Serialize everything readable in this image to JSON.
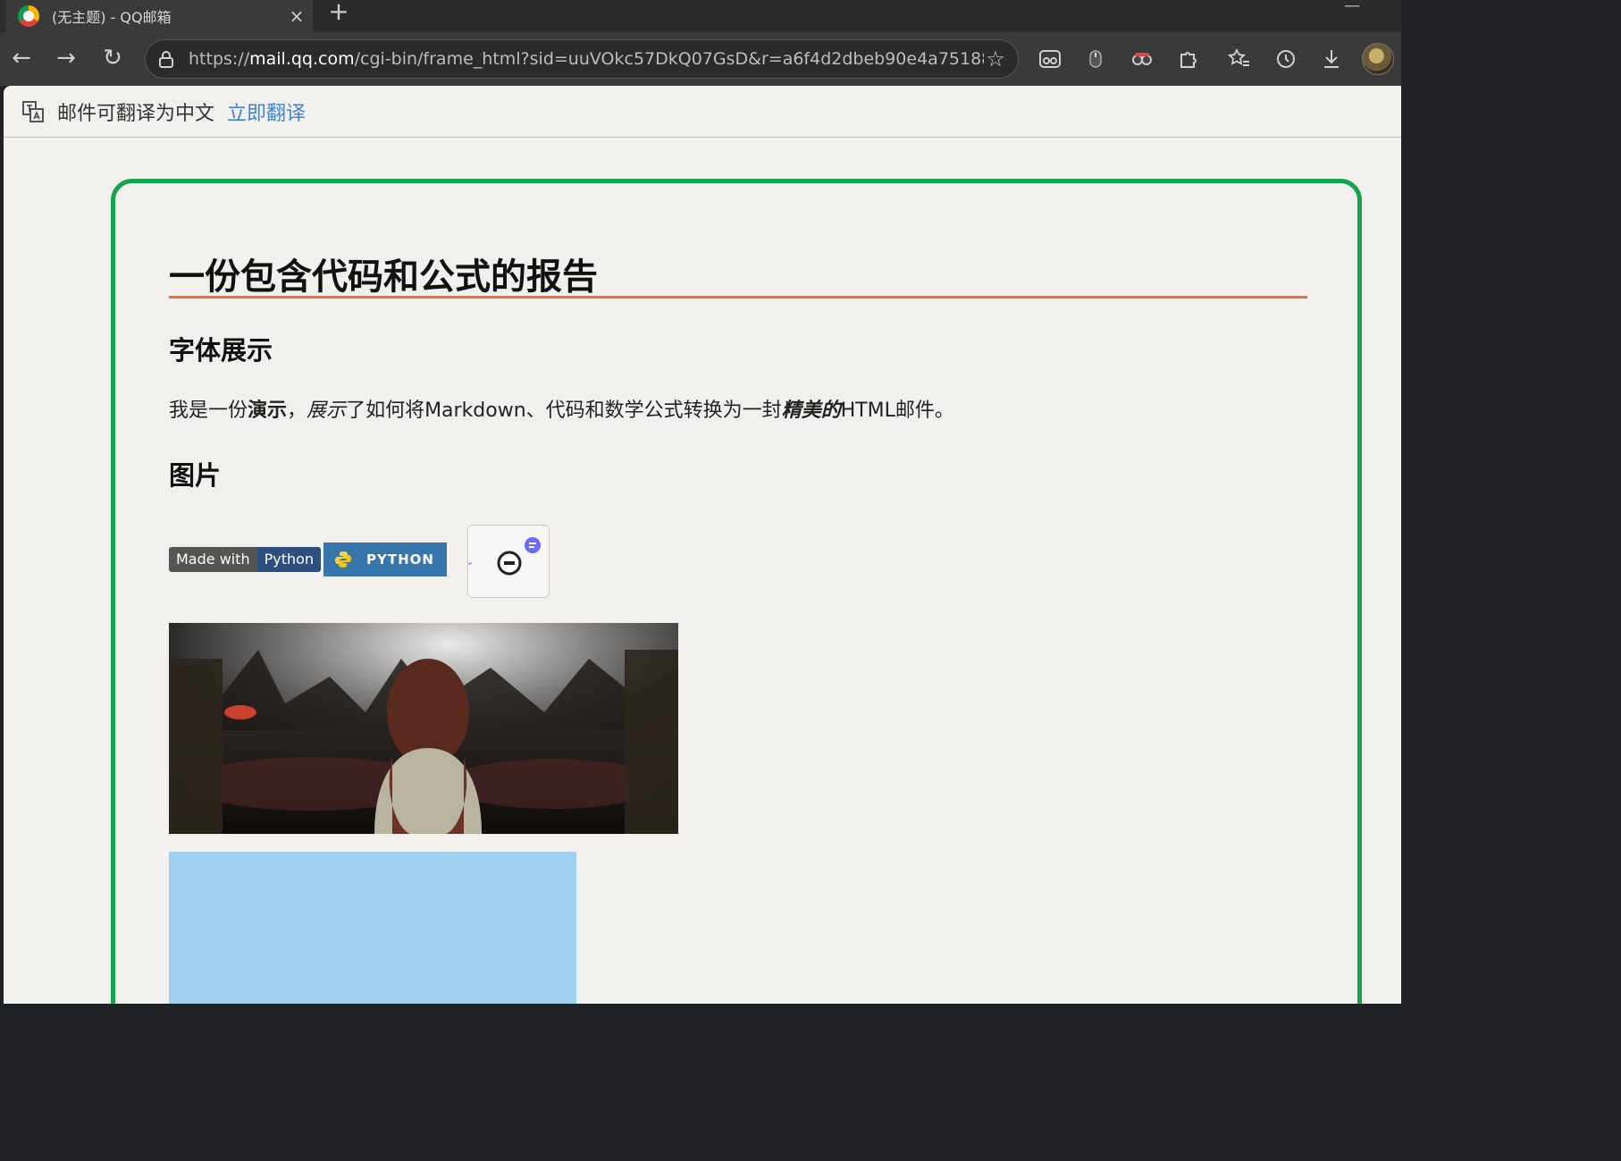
{
  "browser": {
    "tab_title": "(无主题) - QQ邮箱",
    "tab_close": "×",
    "new_tab": "+",
    "url_scheme": "https://",
    "url_host": "mail.qq.com",
    "url_rest": "/cgi-bin/frame_html?sid=uuVOkc57DkQ07GsD&r=a6f4d2dbeb90e4a7518891...",
    "back": "←",
    "forward": "→",
    "reload": "↻",
    "star": "☆",
    "minimize": "—"
  },
  "translate_bar": {
    "text": "邮件可翻译为中文",
    "link": "立即翻译"
  },
  "email": {
    "title": "一份包含代码和公式的报告",
    "section_font": "字体展示",
    "para_1": "我是一份",
    "para_bold": "演示",
    "para_2": "，",
    "para_italic": "展示",
    "para_3": "了如何将Markdown、代码和数学公式转换为一封",
    "para_bold_italic": "精美的",
    "para_4": "HTML邮件。",
    "section_images": "图片",
    "badge_made_left": "Made with",
    "badge_made_right": "Python",
    "badge_python": "PYTHON"
  },
  "colors": {
    "card_border": "#14a44d",
    "title_rule": "#e8703a",
    "link": "#3b86d6",
    "python_badge": "#3776ab"
  }
}
